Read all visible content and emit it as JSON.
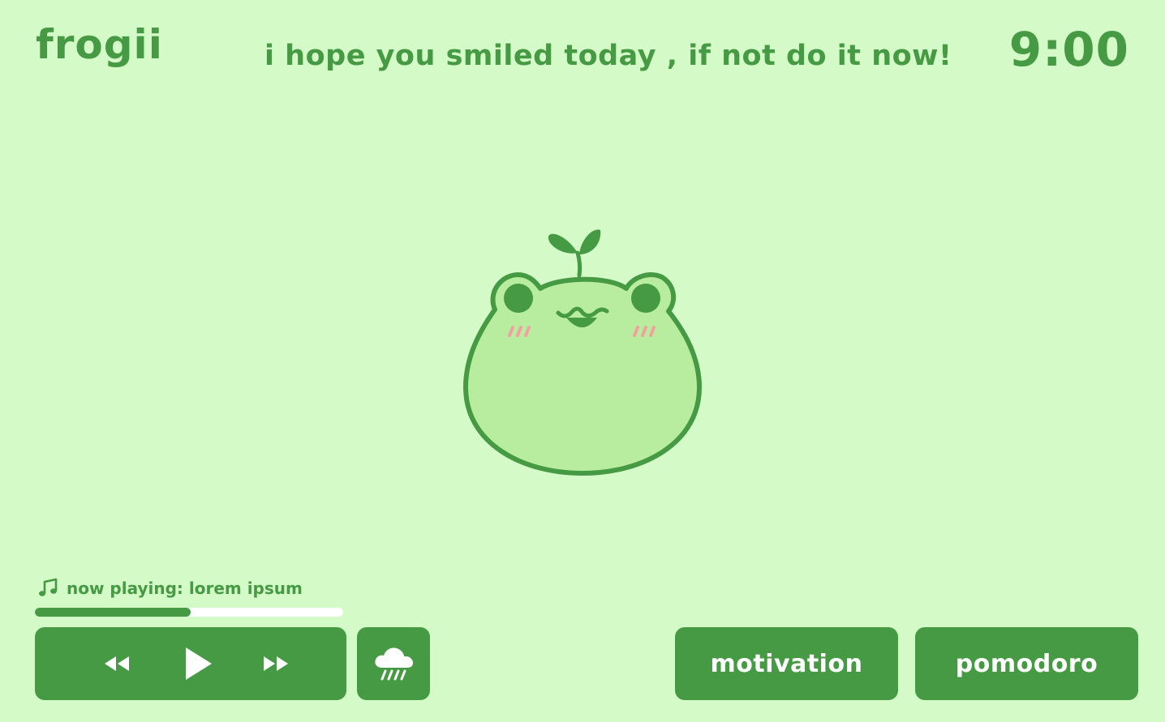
{
  "header": {
    "brand": "frogii",
    "tagline": "i hope you smiled today , if not do it now!",
    "clock": "9:00"
  },
  "mascot": {
    "name": "frog-with-sprout",
    "colors": {
      "outline": "#459a43",
      "body": "#b8eda0",
      "blush": "#f2a1a1"
    }
  },
  "player": {
    "now_playing_label": "now playing: lorem ipsum",
    "progress": 0.505,
    "controls": {
      "rewind_icon": "rewind-icon",
      "play_icon": "play-icon",
      "forward_icon": "fast-forward-icon"
    },
    "ambient_icon": "rain-cloud-icon"
  },
  "actions": {
    "motivation": "motivation",
    "pomodoro": "pomodoro"
  },
  "theme": {
    "background": "#d3fac7",
    "accent": "#459a43",
    "track": "#ffffff"
  }
}
